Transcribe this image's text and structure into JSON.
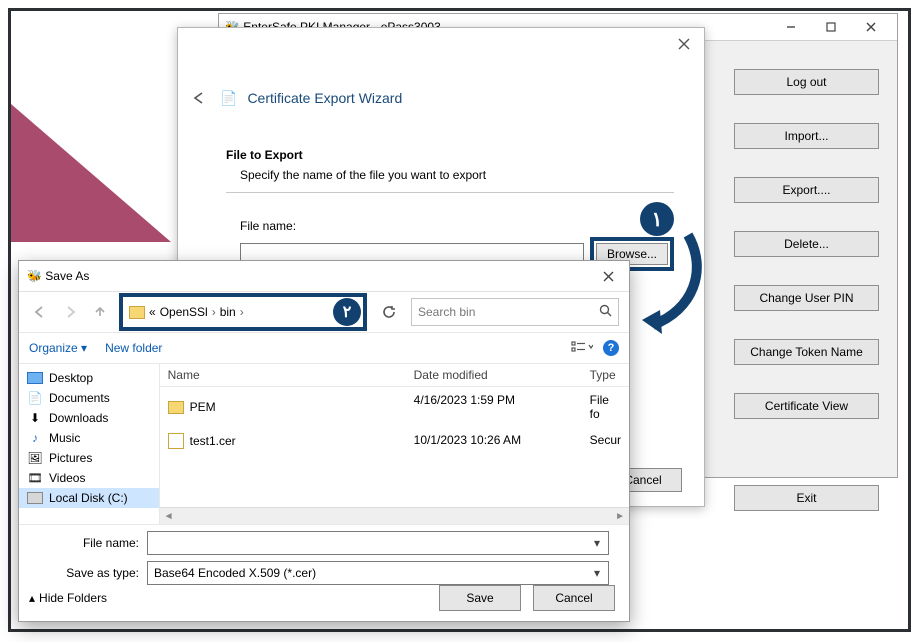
{
  "app": {
    "title": "EnterSafe PKI Manager - ePass3003",
    "buttons": {
      "logout": "Log out",
      "import": "Import...",
      "export": "Export....",
      "delete": "Delete...",
      "change_pin": "Change User PIN",
      "change_token": "Change Token Name",
      "cert_view": "Certificate View",
      "exit": "Exit"
    }
  },
  "wizard": {
    "title": "Certificate Export Wizard",
    "section_title": "File to Export",
    "section_desc": "Specify the name of the file you want to export",
    "file_label": "File name:",
    "browse": "Browse...",
    "cancel": "Cancel"
  },
  "badges": {
    "one": "۱",
    "two": "۲"
  },
  "saveas": {
    "title": "Save As",
    "crumb_prefix": "«",
    "crumb1": "OpenSSl",
    "crumb2": "bin",
    "search_placeholder": "Search bin",
    "organize": "Organize",
    "new_folder": "New folder",
    "tree": {
      "desktop": "Desktop",
      "documents": "Documents",
      "downloads": "Downloads",
      "music": "Music",
      "pictures": "Pictures",
      "videos": "Videos",
      "localdisk": "Local Disk (C:)"
    },
    "columns": {
      "name": "Name",
      "date": "Date modified",
      "type": "Type"
    },
    "rows": [
      {
        "name": "PEM",
        "date": "4/16/2023 1:59 PM",
        "type": "File fo",
        "kind": "folder"
      },
      {
        "name": "test1.cer",
        "date": "10/1/2023 10:26 AM",
        "type": "Secur",
        "kind": "cert"
      }
    ],
    "file_name_label": "File name:",
    "file_name_value": "",
    "save_type_label": "Save as type:",
    "save_type_value": "Base64 Encoded X.509 (*.cer)",
    "hide_folders": "Hide Folders",
    "save": "Save",
    "cancel": "Cancel"
  }
}
